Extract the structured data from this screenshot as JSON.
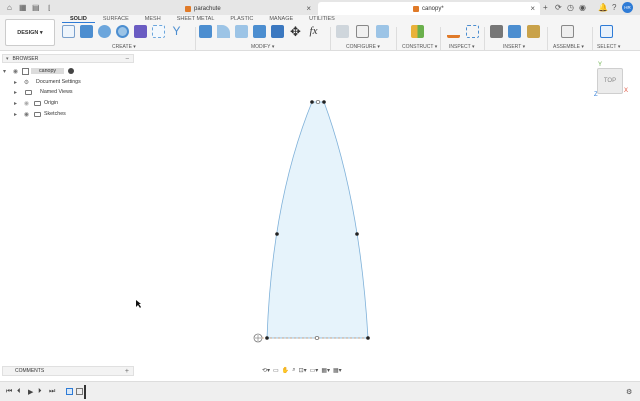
{
  "tabs": {
    "doc1": "parachute",
    "doc2": "canopy*"
  },
  "user_initials": "HR",
  "workspace": {
    "mode": "DESIGN",
    "tabs": [
      "SOLID",
      "SURFACE",
      "MESH",
      "SHEET METAL",
      "PLASTIC",
      "MANAGE",
      "UTILITIES"
    ],
    "groups": [
      "CREATE",
      "MODIFY",
      "CONFIGURE",
      "CONSTRUCT",
      "INSPECT",
      "INSERT",
      "ASSEMBLE",
      "SELECT"
    ]
  },
  "browser": {
    "title": "BROWSER",
    "root": "canopy",
    "items": [
      "Document Settings",
      "Named Views",
      "Origin",
      "Sketches"
    ]
  },
  "viewcube": {
    "label": "TOP"
  },
  "axes": {
    "x": "X",
    "y": "Y",
    "z": "Z"
  },
  "comments": {
    "title": "COMMENTS"
  },
  "colors": {
    "accent": "#2e7bd6",
    "sketch_fill": "#e6f3fb",
    "sketch_line": "#7fb1d9",
    "orange": "#e07a28"
  }
}
